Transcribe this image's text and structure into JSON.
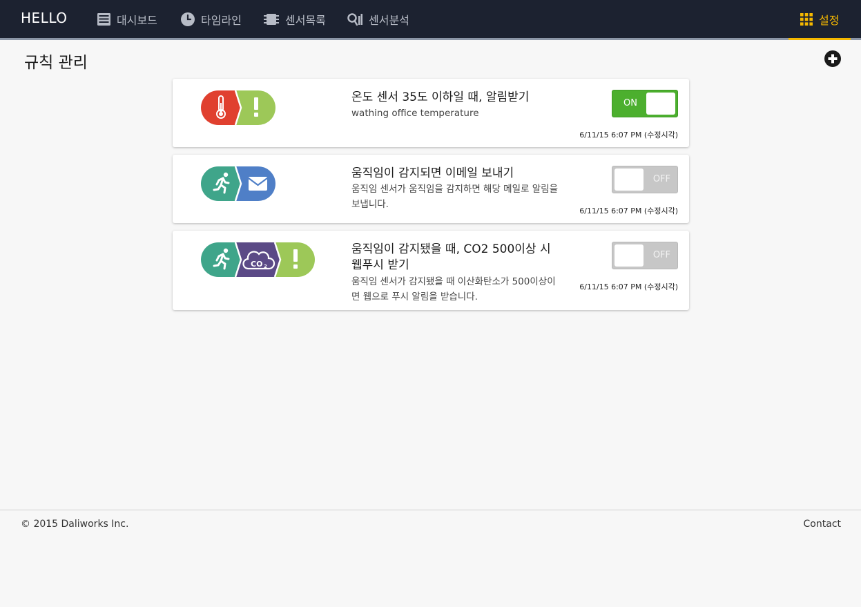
{
  "nav": {
    "brand": "HELLO",
    "items": [
      {
        "label": "대시보드",
        "icon": "dashboard-icon"
      },
      {
        "label": "타임라인",
        "icon": "clock-icon"
      },
      {
        "label": "센서목록",
        "icon": "chip-icon"
      },
      {
        "label": "센서분석",
        "icon": "analysis-icon"
      }
    ],
    "settings": {
      "label": "설정",
      "icon": "grid-icon"
    },
    "active_color": "#f5b800"
  },
  "page": {
    "title": "규칙 관리",
    "add_icon": "plus-circle-icon"
  },
  "rules": [
    {
      "title": "온도 센서 35도 이하일 때, 알림받기",
      "description": "wathing office temperature",
      "toggle": "ON",
      "enabled": true,
      "time": "6/11/15 6:07 PM (수정시각)",
      "icons": [
        {
          "name": "thermometer-icon",
          "color": "#e0402f"
        },
        {
          "name": "alert-icon",
          "color": "#9dc858"
        }
      ]
    },
    {
      "title": "움직임이 감지되면 이메일 보내기",
      "description": "움직임 센서가 움직임을 감지하면 해당 메일로 알림을 보냅니다.",
      "toggle": "OFF",
      "enabled": false,
      "time": "6/11/15 6:07 PM (수정시각)",
      "icons": [
        {
          "name": "running-icon",
          "color": "#3fa58a"
        },
        {
          "name": "envelope-icon",
          "color": "#4f7fc7"
        }
      ]
    },
    {
      "title": "움직임이 감지됐을 때, CO2 500이상 시 웹푸시 받기",
      "description": "움직임 센서가 감지됐을 때 이산화탄소가 500이상이면 웹으로 푸시 알림을 받습니다.",
      "toggle": "OFF",
      "enabled": false,
      "time": "6/11/15 6:07 PM (수정시각)",
      "icons": [
        {
          "name": "running-icon",
          "color": "#3fa58a"
        },
        {
          "name": "co2-cloud-icon",
          "color": "#5b4a86"
        },
        {
          "name": "alert-icon",
          "color": "#9dc858"
        }
      ]
    }
  ],
  "footer": {
    "copyright": "© 2015 Daliworks Inc.",
    "contact": "Contact"
  }
}
